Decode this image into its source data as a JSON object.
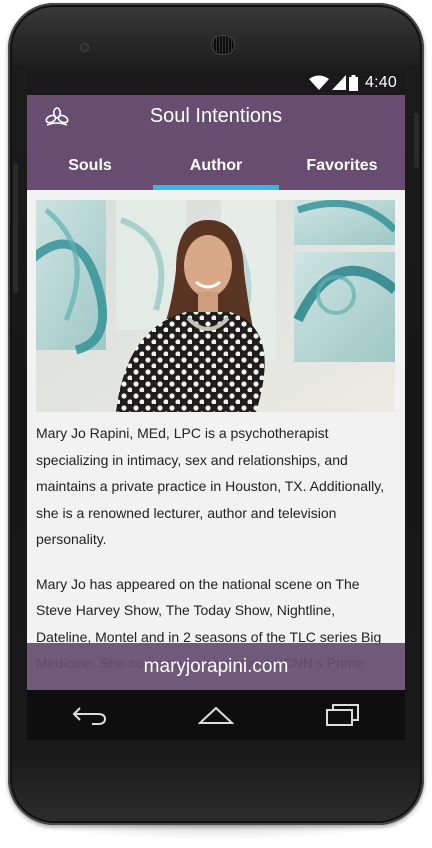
{
  "status_bar": {
    "time": "4:40",
    "icons": [
      "wifi-icon",
      "signal-icon",
      "battery-icon"
    ]
  },
  "app_bar": {
    "title": "Soul Intentions",
    "logo_icon": "lotus-icon",
    "background_color": "#674d70"
  },
  "tabs": [
    {
      "label": "Souls",
      "active": false
    },
    {
      "label": "Author",
      "active": true
    },
    {
      "label": "Favorites",
      "active": false
    }
  ],
  "tab_indicator_color": "#38b6e4",
  "author": {
    "bio_paragraphs": [
      "Mary Jo Rapini, MEd, LPC is a psychotherapist specializing in intimacy, sex and relationships, and maintains a private practice in Houston, TX. Additionally, she is a renowned lecturer, author and television personality.",
      "Mary Jo has appeared on the national scene on The Steve Harvey Show, The Today Show, Nightline, Dateline, Montel and in 2 seasons of the TLC series Big Medicine. She co-hosted a segment on CNN's Prime"
    ]
  },
  "website_bar": {
    "text": "maryjorapini.com"
  },
  "nav_bar": {
    "icons": [
      "back-icon",
      "home-icon",
      "recents-icon"
    ]
  }
}
